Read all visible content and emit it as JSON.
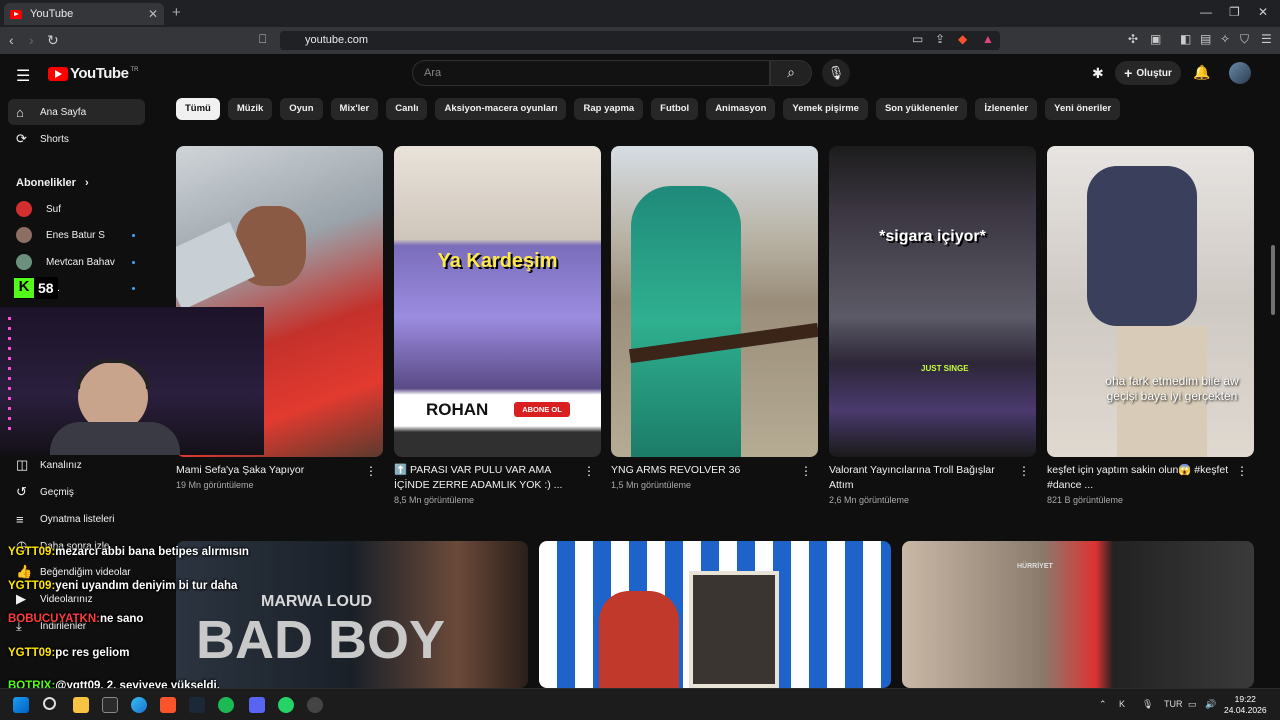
{
  "browser": {
    "tab_title": "YouTube",
    "url": "youtube.com"
  },
  "header": {
    "logo_text": "YouTube",
    "logo_region": "TR",
    "search_placeholder": "Ara",
    "create_label": "Oluştur"
  },
  "sidebar": {
    "items": [
      {
        "label": "Ana Sayfa",
        "icon": "home-icon"
      },
      {
        "label": "Shorts",
        "icon": "shorts-icon"
      }
    ],
    "subs_header": "Abonelikler",
    "subs": [
      {
        "label": "Suf",
        "color": "#d32f2f"
      },
      {
        "label": "Enes Batur S",
        "color": "#8d6e63"
      },
      {
        "label": "Mevtcan Bahav",
        "color": "#6d8f7e"
      },
      {
        "label": "...r.",
        "color": "#444444"
      }
    ],
    "you_items": [
      {
        "label": "Kanalınız",
        "icon": "channel-icon"
      },
      {
        "label": "Geçmiş",
        "icon": "history-icon"
      },
      {
        "label": "Oynatma listeleri",
        "icon": "playlist-icon"
      },
      {
        "label": "Daha sonra izle",
        "icon": "watch-later-icon"
      },
      {
        "label": "Beğendiğim videolar",
        "icon": "like-icon"
      },
      {
        "label": "Videolarınız",
        "icon": "your-videos-icon"
      },
      {
        "label": "İndirilenler",
        "icon": "download-icon"
      }
    ]
  },
  "chips": [
    "Tümü",
    "Müzik",
    "Oyun",
    "Mix'ler",
    "Canlı",
    "Aksiyon-macera oyunları",
    "Rap yapma",
    "Futbol",
    "Animasyon",
    "Yemek pişirme",
    "Son yüklenenler",
    "İzlenenler",
    "Yeni öneriler"
  ],
  "videos": [
    {
      "title": "Mami Sefa'ya Şaka Yapıyor",
      "meta": "19 Mn görüntüleme"
    },
    {
      "title": "⬆️ PARASI VAR PULU VAR AMA İÇİNDE ZERRE ADAMLIK YOK :) ...",
      "meta": "8,5 Mn görüntüleme"
    },
    {
      "title": "YNG ARMS REVOLVER 36",
      "meta": "1,5 Mn görüntüleme"
    },
    {
      "title": "Valorant Yayıncılarına Troll Bağışlar Attım",
      "meta": "2,6 Mn görüntüleme"
    },
    {
      "title": "keşfet için yaptım sakin olun😱 #keşfet #dance ...",
      "meta": "821 B görüntüleme"
    }
  ],
  "thumb_texts": {
    "ya_kardesim": "Ya Kardeşim",
    "rohan": "ROHAN",
    "abone_ol": "ABONE OL",
    "sigara": "*sigara içiyor*",
    "just_singe": "JUST SINGE",
    "oha": "oha fark etmedim bile aw geçişi baya iyi gerçekten",
    "marwa": "MARWA LOUD",
    "bad_boy": "BAD BOY",
    "hurriyet": "HÜRRİYET"
  },
  "stream": {
    "counter": "58",
    "counter_icon": "K"
  },
  "chat": [
    {
      "user": "YGTT09:",
      "msg": "mezarcı abbi bana betipes alırmısın",
      "color": "#ffe600"
    },
    {
      "user": "YGTT09:",
      "msg": "yeni uyandım deniyim bi tur daha",
      "color": "#ffe600"
    },
    {
      "user": "BOBUCUYATKN:",
      "msg": "ne sano",
      "color": "#ff3b3b"
    },
    {
      "user": "YGTT09:",
      "msg": "pc res geliom",
      "color": "#ffe600"
    },
    {
      "user": "BOTRIX:",
      "msg": "@ygtt09, 2. seviyeye yükseldi.",
      "color": "#53fc18"
    }
  ],
  "taskbar": {
    "lang": "TUR",
    "time": "19:22",
    "date": "24.04.2026"
  }
}
